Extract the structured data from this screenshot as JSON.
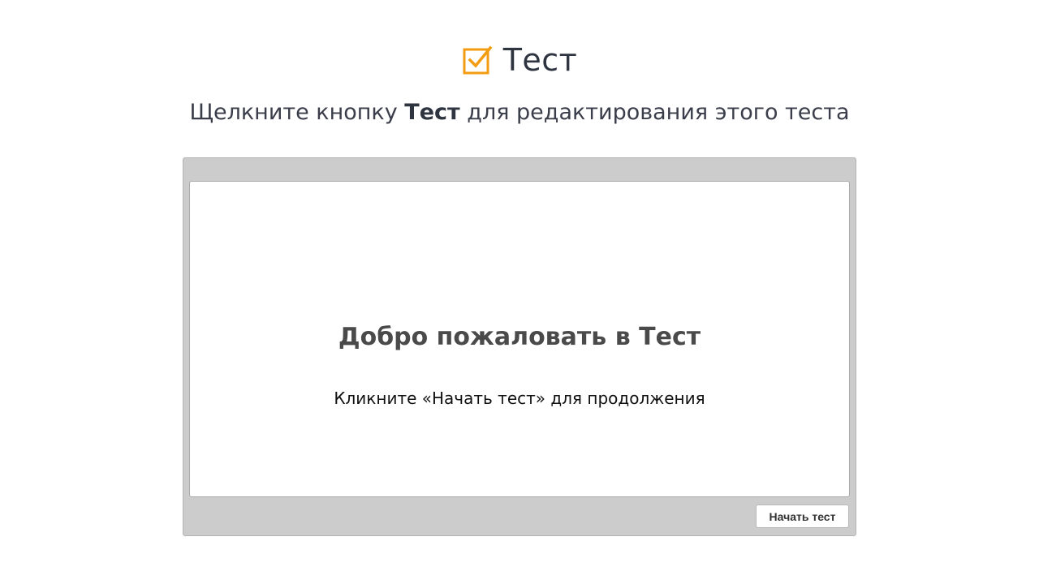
{
  "header": {
    "icon": "checkbox-checked-icon",
    "icon_color": "#f39c12",
    "title": "Тест"
  },
  "subtitle": {
    "before": "Щелкните кнопку ",
    "bold": "Тест",
    "after": " для редактирования этого теста"
  },
  "slide": {
    "heading": "Добро пожаловать в Тест",
    "text": "Кликните «Начать тест» для продолжения"
  },
  "controls": {
    "start_label": "Начать тест"
  },
  "colors": {
    "frame_bg": "#cccccc",
    "accent": "#f39c12"
  }
}
